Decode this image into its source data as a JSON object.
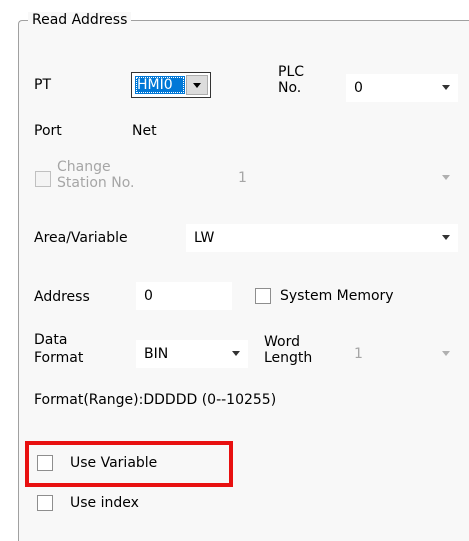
{
  "group": {
    "title": "Read Address"
  },
  "pt": {
    "label": "PT",
    "value": "HMI0"
  },
  "plc": {
    "label_line1": "PLC",
    "label_line2": "No.",
    "value": "0"
  },
  "port": {
    "label": "Port",
    "value": "Net"
  },
  "change_station": {
    "label_line1": "Change",
    "label_line2": "Station No.",
    "value": "1",
    "checked": false,
    "enabled": false
  },
  "area": {
    "label": "Area/Variable",
    "value": "LW"
  },
  "address": {
    "label": "Address",
    "value": "0"
  },
  "system_memory": {
    "label": "System Memory",
    "checked": false
  },
  "data_format": {
    "label_line1": "Data",
    "label_line2": "Format",
    "value": "BIN"
  },
  "word_length": {
    "label_line1": "Word",
    "label_line2": "Length",
    "value": "1",
    "enabled": false
  },
  "format_range": {
    "text": "Format(Range):DDDDD (0--10255)"
  },
  "use_variable": {
    "label": "Use Variable",
    "checked": false
  },
  "use_index": {
    "label": "Use index",
    "checked": false
  },
  "colors": {
    "highlight": "#e81010",
    "selection": "#0078d7"
  }
}
